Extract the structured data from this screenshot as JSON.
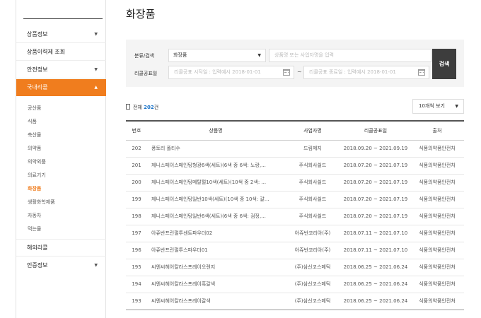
{
  "sidebar": {
    "items": [
      {
        "label": "상품정보",
        "chevron": "▼"
      },
      {
        "label": "상품이력제 조회",
        "chevron": ""
      },
      {
        "label": "안전정보",
        "chevron": "▼"
      },
      {
        "label": "국내리콜",
        "chevron": "▲"
      },
      {
        "label": "해외리콜",
        "chevron": ""
      },
      {
        "label": "인증정보",
        "chevron": "▼"
      }
    ],
    "subitems": [
      "공산품",
      "식품",
      "축산물",
      "의약품",
      "의약외품",
      "의료기기",
      "화장품",
      "생활화학제품",
      "자동차",
      "먹는물"
    ]
  },
  "page": {
    "title": "화장품"
  },
  "search": {
    "category_label": "분류/검색",
    "category_value": "화장품",
    "keyword_placeholder": "상품명 또는 사업자명을 입력",
    "recall_label": "리콜공표일",
    "start_placeholder": "리콜공표 시작일 : 입력예시 2018-01-01",
    "tilde": "~",
    "end_placeholder": "리콜공표 종료일 : 입력예시 2018-01-01",
    "button_label": "검색"
  },
  "summary": {
    "prefix": "전체",
    "count": "202",
    "suffix": "건"
  },
  "per_page": {
    "value": "10개씩 보기"
  },
  "table": {
    "headers": [
      "번호",
      "상품명",
      "사업자명",
      "리콜공표일",
      "출처"
    ],
    "rows": [
      {
        "no": "202",
        "name": "퐁토리 폴티수",
        "company": "드림제지",
        "date": "2018.09.20 ~ 2021.09.19",
        "source": "식품의약품안전처"
      },
      {
        "no": "201",
        "name": "제니스페이스페인팅형광6색(세트)(6색 중 6색: 노랑,...",
        "company": "주식회사쉴드",
        "date": "2018.07.20 ~ 2021.07.19",
        "source": "식품의약품안전처"
      },
      {
        "no": "200",
        "name": "제니스페이스페인팅메탈펄10색(세트)(10색 중 2색: ...",
        "company": "주식회사쉴드",
        "date": "2018.07.20 ~ 2021.07.19",
        "source": "식품의약품안전처"
      },
      {
        "no": "199",
        "name": "제니스페이스페인팅일반10색(세트)(10색 중 10색: 갈...",
        "company": "주식회사쉴드",
        "date": "2018.07.20 ~ 2021.07.19",
        "source": "식품의약품안전처"
      },
      {
        "no": "198",
        "name": "제니스페이스페인팅일반6색(세트)(6색 중 6색: 검정,...",
        "company": "주식회사쉴드",
        "date": "2018.07.20 ~ 2021.07.19",
        "source": "식품의약품안전처"
      },
      {
        "no": "197",
        "name": "아쥬반프린펄투센트파우더02",
        "company": "아쥬반코리아(주)",
        "date": "2018.07.11 ~ 2021.07.10",
        "source": "식품의약품안전처"
      },
      {
        "no": "196",
        "name": "아쥬반프린펄투스파우더01",
        "company": "아쥬반코리아(주)",
        "date": "2018.07.11 ~ 2021.07.10",
        "source": "식품의약품안전처"
      },
      {
        "no": "195",
        "name": "씨엔씨헤어칼라스프레이오렌지",
        "company": "(주)삼신코스메틱",
        "date": "2018.06.25 ~ 2021.06.24",
        "source": "식품의약품안전처"
      },
      {
        "no": "194",
        "name": "씨엔씨헤어칼라스프레이흑갈색",
        "company": "(주)삼신코스메틱",
        "date": "2018.06.25 ~ 2021.06.24",
        "source": "식품의약품안전처"
      },
      {
        "no": "193",
        "name": "씨엔씨헤어칼라스프레이갈색",
        "company": "(주)삼신코스메틱",
        "date": "2018.06.25 ~ 2021.06.24",
        "source": "식품의약품안전처"
      }
    ]
  },
  "colors": {
    "accent": "#f07d1e",
    "link_blue": "#1a73c8",
    "button_dark": "#3d3d3d"
  }
}
